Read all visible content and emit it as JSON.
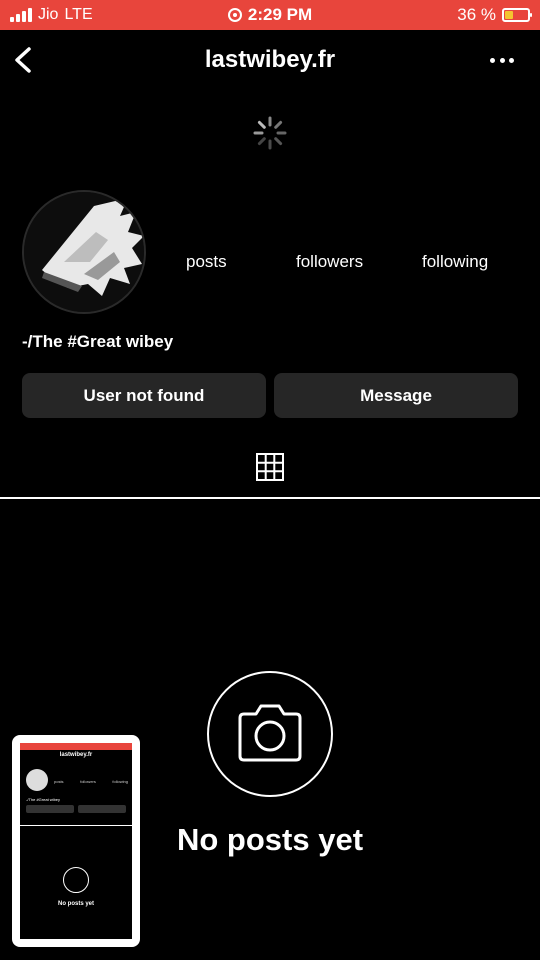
{
  "status_bar": {
    "carrier": "Jio",
    "network": "LTE",
    "time": "2:29 PM",
    "battery_percent": "36 %",
    "battery_level": 0.36,
    "bar_color": "#e8453c"
  },
  "header": {
    "title": "lastwibey.fr",
    "back_icon": "chevron-left-icon",
    "more_icon": "more-horizontal-icon"
  },
  "profile": {
    "stats": {
      "posts_label": "posts",
      "followers_label": "followers",
      "following_label": "following"
    },
    "bio": "-/The #Great wibey",
    "buttons": {
      "follow_label": "User not found",
      "message_label": "Message"
    }
  },
  "tabs": {
    "grid_icon": "grid-icon"
  },
  "empty_state": {
    "icon": "camera-icon",
    "text": "No posts yet"
  },
  "thumbnail": {
    "title": "lastwibey.fr",
    "posts_label": "posts",
    "followers_label": "followers",
    "following_label": "following",
    "bio": "-/The #Great wibey",
    "empty_text": "No posts yet"
  }
}
